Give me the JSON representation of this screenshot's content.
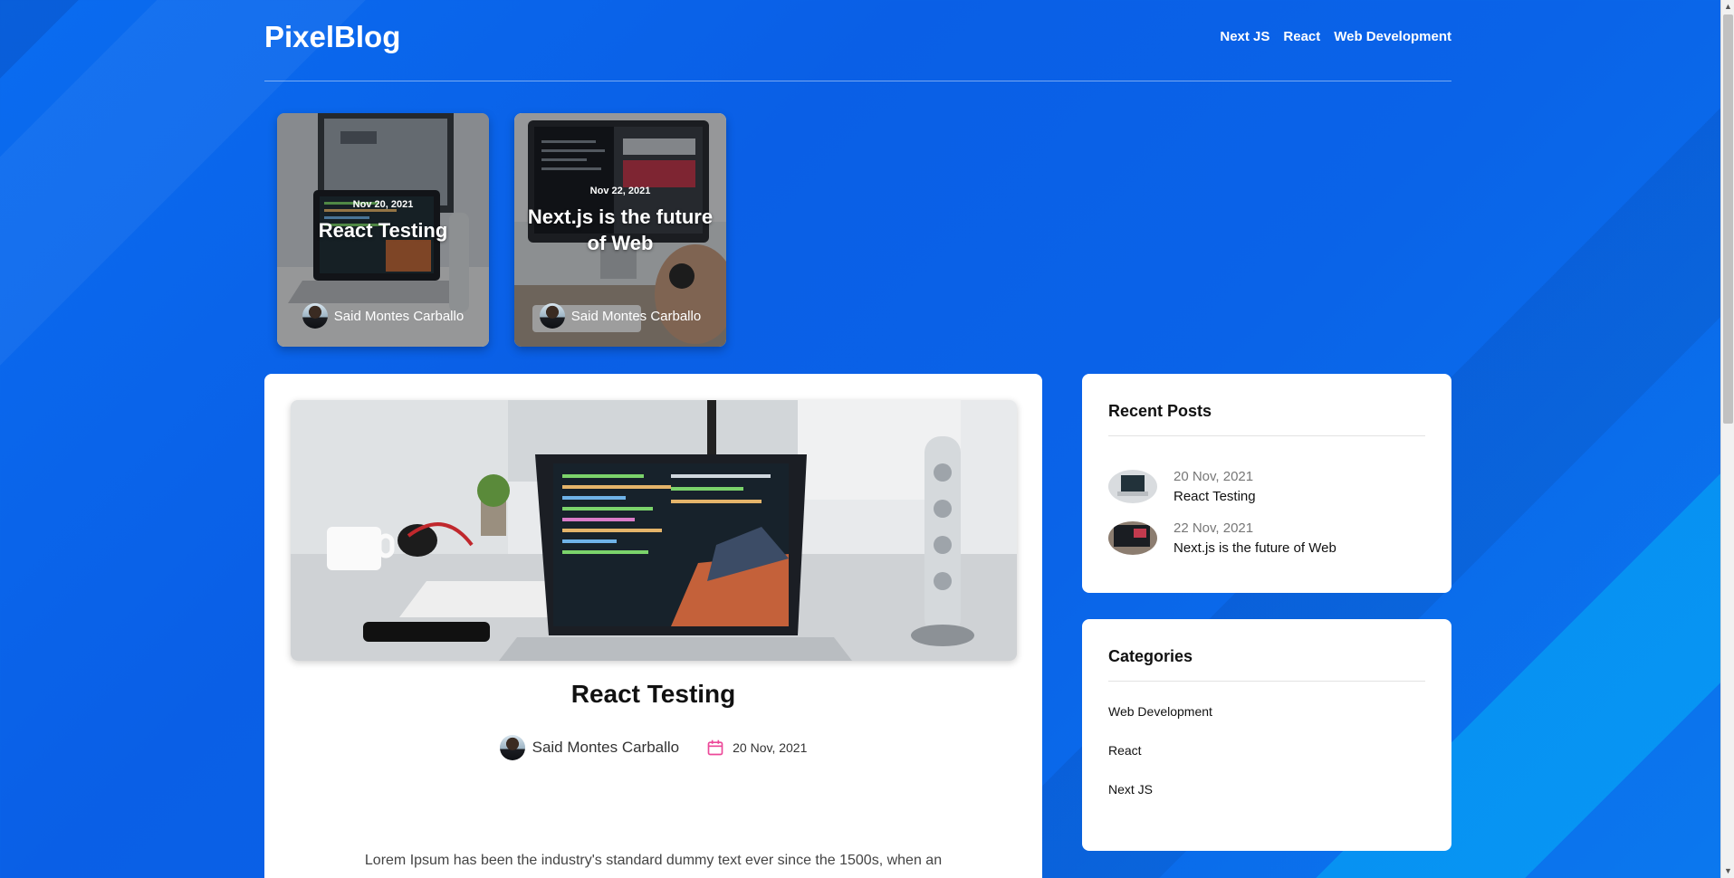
{
  "site": {
    "logo": "PixelBlog"
  },
  "nav": {
    "items": [
      "Next JS",
      "React",
      "Web Development"
    ]
  },
  "featured": [
    {
      "date": "Nov 20, 2021",
      "title": "React Testing",
      "author": "Said Montes Carballo"
    },
    {
      "date": "Nov 22, 2021",
      "title": "Next.js is the future of Web",
      "author": "Said Montes Carballo"
    }
  ],
  "post": {
    "title": "React Testing",
    "author": "Said Montes Carballo",
    "date": "20 Nov, 2021",
    "excerpt": "Lorem Ipsum has been the industry's standard dummy text ever since the 1500s, when an"
  },
  "recent": {
    "heading": "Recent Posts",
    "items": [
      {
        "date": "20 Nov, 2021",
        "title": "React Testing"
      },
      {
        "date": "22 Nov, 2021",
        "title": "Next.js is the future of Web"
      }
    ]
  },
  "categories": {
    "heading": "Categories",
    "items": [
      "Web Development",
      "React",
      "Next JS"
    ]
  },
  "colors": {
    "accent_pink": "#ec4899",
    "background_blue": "#0a63e8"
  }
}
